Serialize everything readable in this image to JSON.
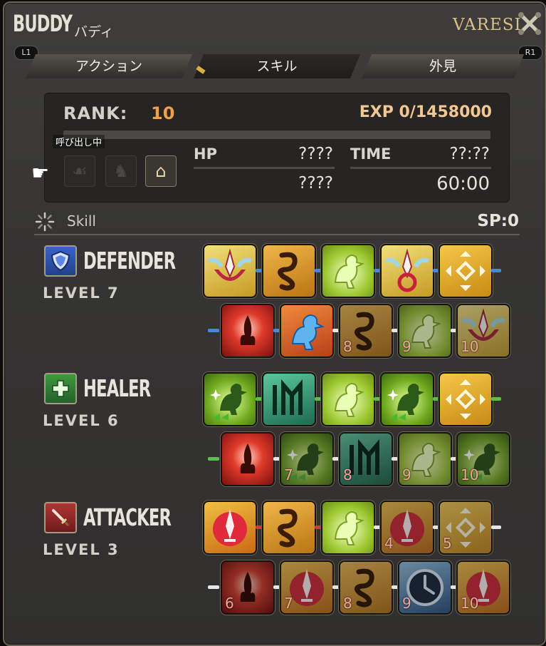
{
  "header": {
    "title": "BUDDY",
    "subtitle": "バディ",
    "player": "VARESI",
    "l1": "L1",
    "r1": "R1"
  },
  "tabs": [
    {
      "label": "アクション"
    },
    {
      "label": "スキル"
    },
    {
      "label": "外見"
    }
  ],
  "info": {
    "rank_label": "RANK:",
    "rank": "10",
    "exp": "EXP 0/1458000",
    "exp_fraction": 0,
    "called": "呼び出し中",
    "hp_label": "HP",
    "hp_max": "????",
    "hp_cur": "????",
    "time_label": "TIME",
    "time_max": "??:??",
    "time_cur": "60:00"
  },
  "skill": {
    "label": "Skill",
    "sp": "SP:0"
  },
  "roles": [
    {
      "name": "DEFENDER",
      "level": "LEVEL 7",
      "icon": "shield-icon",
      "color": "#3a63c8",
      "skills": [
        {
          "icon": "sword-shield",
          "num": ""
        },
        {
          "icon": "knot",
          "num": ""
        },
        {
          "icon": "chocobo",
          "num": ""
        },
        {
          "icon": "sword-ring",
          "num": ""
        },
        {
          "icon": "diamond-arrows",
          "num": ""
        },
        {
          "icon": "flame-burst",
          "num": ""
        },
        {
          "icon": "ice-chocobo",
          "num": ""
        },
        {
          "icon": "knot",
          "num": "8"
        },
        {
          "icon": "chocobo",
          "num": "9"
        },
        {
          "icon": "sword-shield",
          "num": "10"
        }
      ]
    },
    {
      "name": "HEALER",
      "level": "LEVEL 6",
      "icon": "cross-icon",
      "color": "#3e9a3e",
      "skills": [
        {
          "icon": "heal-chocobo",
          "num": ""
        },
        {
          "icon": "rune",
          "num": ""
        },
        {
          "icon": "chocobo",
          "num": ""
        },
        {
          "icon": "heal-chocobo",
          "num": ""
        },
        {
          "icon": "diamond-arrows",
          "num": ""
        },
        {
          "icon": "flame-burst",
          "num": ""
        },
        {
          "icon": "heal-chocobo",
          "num": "7"
        },
        {
          "icon": "rune",
          "num": "8"
        },
        {
          "icon": "chocobo",
          "num": "9"
        },
        {
          "icon": "heal-chocobo",
          "num": "10"
        }
      ]
    },
    {
      "name": "ATTACKER",
      "level": "LEVEL 3",
      "icon": "sword-icon",
      "color": "#b23434",
      "skills": [
        {
          "icon": "sword-red",
          "num": ""
        },
        {
          "icon": "knot",
          "num": ""
        },
        {
          "icon": "chocobo",
          "num": ""
        },
        {
          "icon": "sword-red",
          "num": "4"
        },
        {
          "icon": "diamond-arrows",
          "num": "5"
        },
        {
          "icon": "flame-burst",
          "num": "6"
        },
        {
          "icon": "sword-red",
          "num": "7"
        },
        {
          "icon": "knot",
          "num": "8"
        },
        {
          "icon": "clock",
          "num": "9"
        },
        {
          "icon": "sword-red",
          "num": "10"
        }
      ]
    }
  ]
}
